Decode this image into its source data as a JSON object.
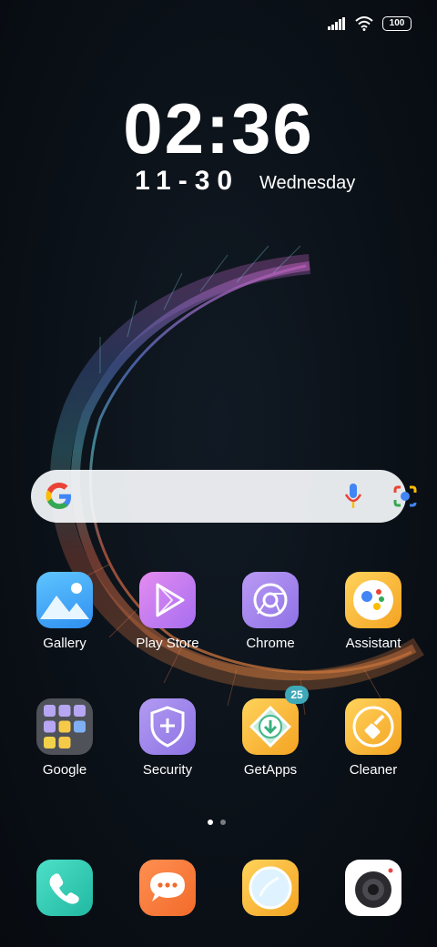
{
  "status": {
    "battery": "100"
  },
  "clock": {
    "time": "02:36",
    "date": "11-30",
    "weekday": "Wednesday"
  },
  "search_bar": {
    "has_mic": true,
    "has_lens": true
  },
  "apps_row1": [
    {
      "label": "Gallery",
      "icon": "gallery-icon"
    },
    {
      "label": "Play Store",
      "icon": "play-store-icon"
    },
    {
      "label": "Chrome",
      "icon": "chrome-icon"
    },
    {
      "label": "Assistant",
      "icon": "assistant-icon"
    }
  ],
  "apps_row2": [
    {
      "label": "Google",
      "icon": "google-folder-icon"
    },
    {
      "label": "Security",
      "icon": "security-icon"
    },
    {
      "label": "GetApps",
      "icon": "getapps-icon",
      "badge": "25"
    },
    {
      "label": "Cleaner",
      "icon": "cleaner-icon"
    }
  ],
  "dock": [
    {
      "icon": "phone-icon"
    },
    {
      "icon": "messages-icon"
    },
    {
      "icon": "browser-icon"
    },
    {
      "icon": "camera-icon"
    }
  ],
  "page_indicator": {
    "pages": 2,
    "current": 1
  }
}
